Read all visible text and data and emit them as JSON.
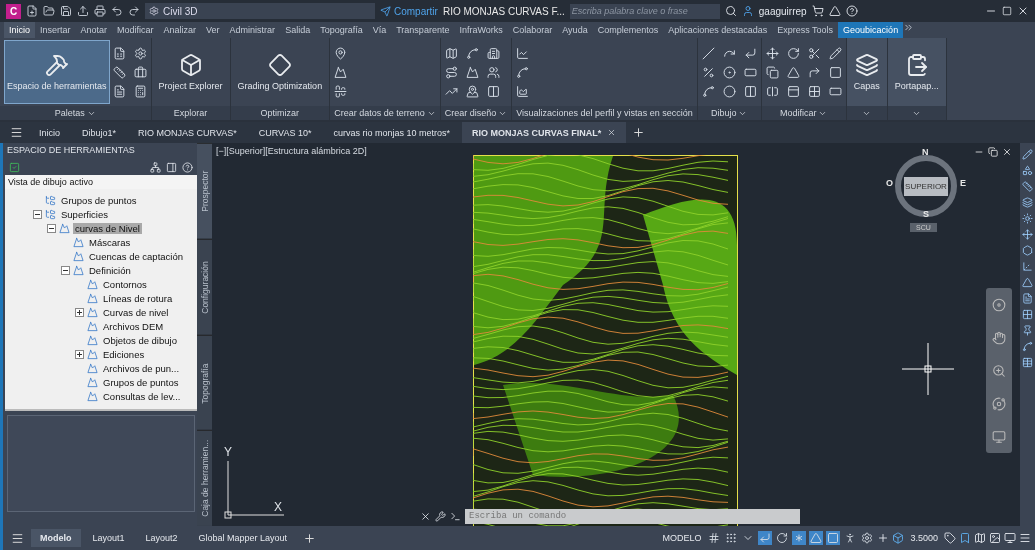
{
  "title_bar": {
    "app_button": "C",
    "workspace": "Civil 3D",
    "share": "Compartir",
    "title": "RIO MONJAS CURVAS F...",
    "search": {
      "placeholder": "Escriba palabra clave o frase"
    },
    "user": "gaaguirrep"
  },
  "ribbon_tabs": [
    {
      "label": "Inicio",
      "selected": true,
      "kind": "tab"
    },
    {
      "label": "Insertar",
      "selected": false,
      "kind": "tab"
    },
    {
      "label": "Anotar",
      "selected": false,
      "kind": "tab"
    },
    {
      "label": "Modificar",
      "selected": false,
      "kind": "tab"
    },
    {
      "label": "Analizar",
      "selected": false,
      "kind": "tab"
    },
    {
      "label": "Ver",
      "selected": false,
      "kind": "tab"
    },
    {
      "label": "Administrar",
      "selected": false,
      "kind": "tab"
    },
    {
      "label": "Salida",
      "selected": false,
      "kind": "tab"
    },
    {
      "label": "Topografía",
      "selected": false,
      "kind": "tab"
    },
    {
      "label": "Vía",
      "selected": false,
      "kind": "tab"
    },
    {
      "label": "Transparente",
      "selected": false,
      "kind": "tab"
    },
    {
      "label": "InfraWorks",
      "selected": false,
      "kind": "tab"
    },
    {
      "label": "Colaborar",
      "selected": false,
      "kind": "tab"
    },
    {
      "label": "Ayuda",
      "selected": false,
      "kind": "tab"
    },
    {
      "label": "Complementos",
      "selected": false,
      "kind": "tab"
    },
    {
      "label": "Aplicaciones destacadas",
      "selected": false,
      "kind": "tab"
    },
    {
      "label": "Express Tools",
      "selected": false,
      "kind": "tab"
    },
    {
      "label": "Geoubicación",
      "selected": false,
      "kind": "contextual"
    }
  ],
  "ribbon_panels": [
    {
      "label": "Paletas",
      "has_menu": true,
      "buttons": [
        "Espacio de herramientas"
      ],
      "kind": "tools"
    },
    {
      "label": "Explorar",
      "has_menu": false,
      "buttons": [
        "Project Explorer"
      ],
      "kind": "tools"
    },
    {
      "label": "Optimizar",
      "has_menu": false,
      "buttons": [
        "Grading Optimization"
      ],
      "kind": "tools"
    },
    {
      "label": "Crear datos de terreno",
      "has_menu": true,
      "kind": "tools"
    },
    {
      "label": "Crear diseño",
      "has_menu": true,
      "kind": "tools"
    },
    {
      "label": "Visualizaciones del perfil y vistas en sección",
      "has_menu": false,
      "kind": "tools"
    },
    {
      "label": "Dibujo",
      "has_menu": true,
      "kind": "tools"
    },
    {
      "label": "Modificar",
      "has_menu": true,
      "kind": "tools"
    },
    {
      "has_menu": true,
      "buttons": [
        "Capas"
      ],
      "kind": "shaded"
    },
    {
      "has_menu": true,
      "buttons": [
        "Portapap..."
      ],
      "kind": "shaded"
    }
  ],
  "document_tabs": [
    {
      "label": "Inicio",
      "selected": false
    },
    {
      "label": "Dibujo1*",
      "selected": false
    },
    {
      "label": "RIO MONJAS CURVAS*",
      "selected": false
    },
    {
      "label": "CURVAS 10*",
      "selected": false
    },
    {
      "label": "curvas rio monjas 10 metros*",
      "selected": false
    },
    {
      "label": "RIO MONJAS CURVAS FINAL*",
      "selected": true
    }
  ],
  "palette": {
    "title": "ESPACIO DE HERRAMIENTAS",
    "view_select": "Vista de dibujo activo",
    "tree": [
      {
        "label": "Grupos de puntos",
        "selected": false
      },
      {
        "label": "Superficies",
        "expanded": true,
        "selected": false,
        "children": [
          {
            "label": "curvas de Nivel",
            "expanded": true,
            "selected": true,
            "children": [
              {
                "label": "Máscaras",
                "selected": false
              },
              {
                "label": "Cuencas de captación",
                "selected": false
              },
              {
                "label": "Definición",
                "expanded": true,
                "selected": false,
                "children": [
                  {
                    "label": "Contornos",
                    "selected": false
                  },
                  {
                    "label": "Líneas de rotura",
                    "selected": false
                  },
                  {
                    "label": "Curvas de nivel",
                    "expanded": false,
                    "selected": false
                  },
                  {
                    "label": "Archivos DEM",
                    "selected": false
                  },
                  {
                    "label": "Objetos de dibujo",
                    "selected": false
                  },
                  {
                    "label": "Ediciones",
                    "expanded": false,
                    "selected": false
                  },
                  {
                    "label": "Archivos de pun...",
                    "selected": false
                  },
                  {
                    "label": "Grupos de puntos",
                    "selected": false
                  },
                  {
                    "label": "Consultas de lev...",
                    "selected": false
                  }
                ]
              }
            ]
          }
        ]
      }
    ],
    "side_tabs": [
      {
        "label": "Prospector",
        "selected": true
      },
      {
        "label": "Configuración",
        "selected": false
      },
      {
        "label": "Topografía",
        "selected": false
      },
      {
        "label": "Caja de herramien...",
        "selected": false
      }
    ]
  },
  "viewport": {
    "view_label": "[−][Superior][Estructura alámbrica 2D]",
    "viewcube": {
      "north": "N",
      "south": "S",
      "east": "E",
      "west": "O",
      "face": "SUPERIOR",
      "ucs": "SCU"
    },
    "ucs_axes": {
      "y": "Y",
      "x": "X"
    },
    "command": {
      "placeholder": "Escriba un comando"
    }
  },
  "status_bar": {
    "layout_tabs": [
      {
        "label": "Modelo",
        "selected": true
      },
      {
        "label": "Layout1",
        "selected": false
      },
      {
        "label": "Layout2",
        "selected": false
      },
      {
        "label": "Global Mapper Layout",
        "selected": false
      }
    ],
    "space": "MODELO",
    "scale": "3.5000",
    "toggles": [
      {
        "on": false
      },
      {
        "on": false
      },
      {
        "on": false
      },
      {
        "on": true
      },
      {
        "on": false
      },
      {
        "on": true
      },
      {
        "on": true
      },
      {
        "on": true
      },
      {
        "on": false
      },
      {
        "on": false
      }
    ]
  }
}
